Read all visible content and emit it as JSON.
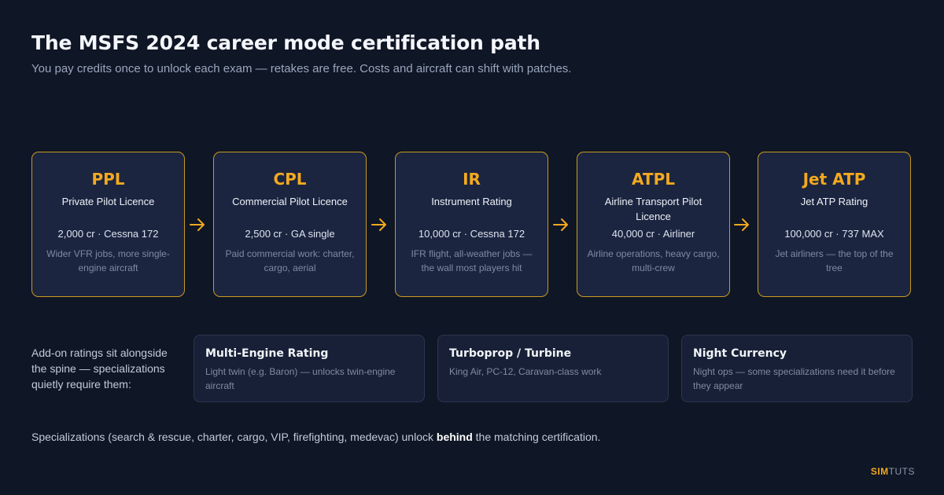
{
  "header": {
    "title": "The MSFS 2024 career mode certification path",
    "subtitle": "You pay credits once to unlock each exam — retakes are free. Costs and aircraft can shift with patches."
  },
  "certifications": [
    {
      "abbr": "PPL",
      "name": "Private Pilot Licence",
      "cost": "2,000 cr · Cessna 172",
      "desc": "Wider VFR jobs, more single-engine aircraft"
    },
    {
      "abbr": "CPL",
      "name": "Commercial Pilot Licence",
      "cost": "2,500 cr · GA single",
      "desc": "Paid commercial work: charter, cargo, aerial"
    },
    {
      "abbr": "IR",
      "name": "Instrument Rating",
      "cost": "10,000 cr · Cessna 172",
      "desc": "IFR flight, all-weather jobs — the wall most players hit"
    },
    {
      "abbr": "ATPL",
      "name": "Airline Transport Pilot Licence",
      "cost": "40,000 cr · Airliner",
      "desc": "Airline operations, heavy cargo, multi-crew"
    },
    {
      "abbr": "Jet ATP",
      "name": "Jet ATP Rating",
      "cost": "100,000 cr · 737 MAX",
      "desc": "Jet airliners — the top of the tree"
    }
  ],
  "addons": {
    "intro": "Add-on ratings sit alongside the spine — specializations quietly require them:",
    "items": [
      {
        "name": "Multi-Engine Rating",
        "desc": "Light twin (e.g. Baron) — unlocks twin-engine aircraft"
      },
      {
        "name": "Turboprop / Turbine",
        "desc": "King Air, PC-12, Caravan-class work"
      },
      {
        "name": "Night Currency",
        "desc": "Night ops — some specializations need it before they appear"
      }
    ]
  },
  "footnote": {
    "before": "Specializations (search & rescue, charter, cargo, VIP, firefighting, medevac) unlock ",
    "emphasis": "behind",
    "after": " the matching certification."
  },
  "brand": {
    "part1": "SIM",
    "part2": "TUTS"
  },
  "colors": {
    "background": "#0f1625",
    "accent": "#f3a91f",
    "card_border": "#c99a22",
    "card_fill": "#1b2540"
  },
  "icons": {
    "connector": "arrow-right-icon"
  }
}
